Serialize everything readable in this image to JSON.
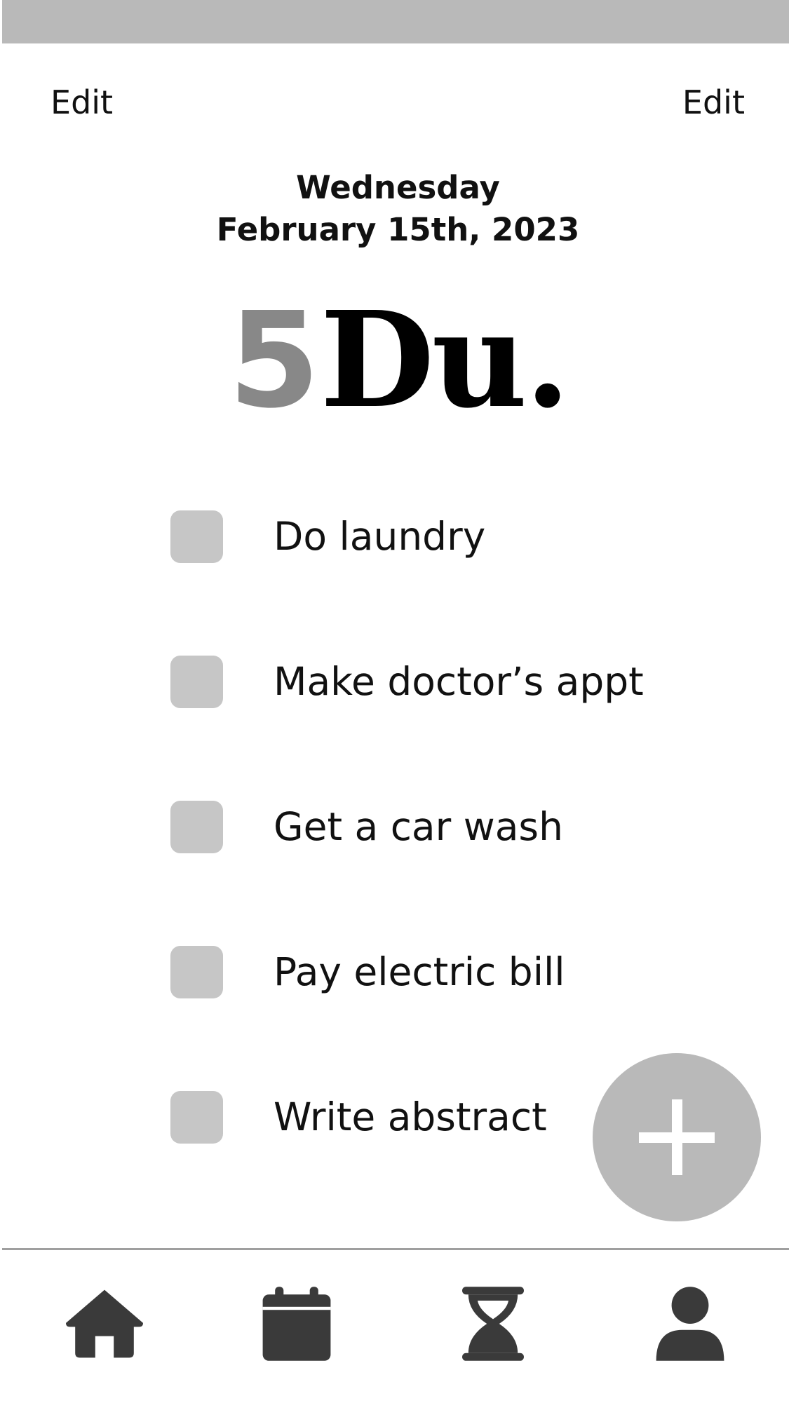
{
  "header": {
    "left_edit_label": "Edit",
    "right_edit_label": "Edit"
  },
  "date": {
    "weekday": "Wednesday",
    "full_date": "February 15th, 2023"
  },
  "logo": {
    "number": "5",
    "word": "Du."
  },
  "tasks": [
    {
      "label": "Do laundry",
      "checked": false
    },
    {
      "label": "Make doctor’s appt",
      "checked": false
    },
    {
      "label": "Get a car wash",
      "checked": false
    },
    {
      "label": "Pay electric bill",
      "checked": false
    },
    {
      "label": "Write abstract",
      "checked": false
    }
  ],
  "fab": {
    "icon": "plus-icon"
  },
  "tab_bar": {
    "items": [
      {
        "icon": "home-icon"
      },
      {
        "icon": "calendar-icon"
      },
      {
        "icon": "hourglass-icon"
      },
      {
        "icon": "user-icon"
      }
    ]
  },
  "colors": {
    "status_bar": "#b9b9b9",
    "checkbox": "#c6c6c6",
    "logo_number": "#888888",
    "fab": "#b9b9b9",
    "icon": "#3a3a3a"
  }
}
